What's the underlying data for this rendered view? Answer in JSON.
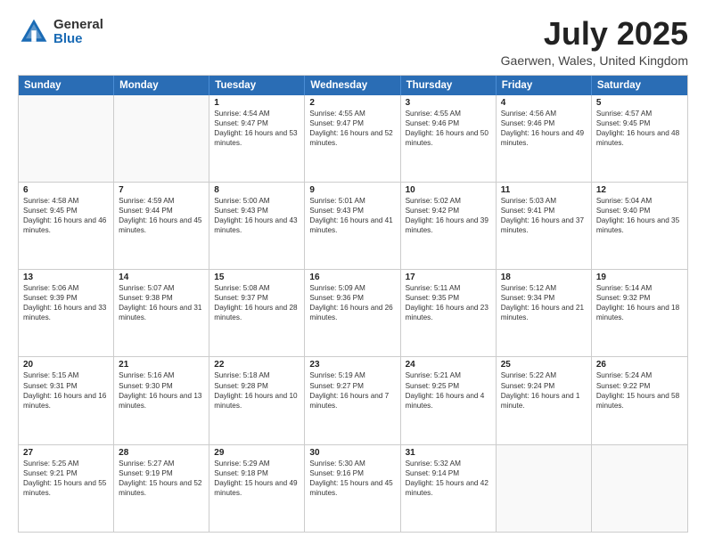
{
  "header": {
    "logo": {
      "general": "General",
      "blue": "Blue"
    },
    "title": "July 2025",
    "subtitle": "Gaerwen, Wales, United Kingdom"
  },
  "calendar": {
    "days": [
      "Sunday",
      "Monday",
      "Tuesday",
      "Wednesday",
      "Thursday",
      "Friday",
      "Saturday"
    ],
    "rows": [
      [
        {
          "day": "",
          "empty": true
        },
        {
          "day": "",
          "empty": true
        },
        {
          "day": "1",
          "sunrise": "Sunrise: 4:54 AM",
          "sunset": "Sunset: 9:47 PM",
          "daylight": "Daylight: 16 hours and 53 minutes."
        },
        {
          "day": "2",
          "sunrise": "Sunrise: 4:55 AM",
          "sunset": "Sunset: 9:47 PM",
          "daylight": "Daylight: 16 hours and 52 minutes."
        },
        {
          "day": "3",
          "sunrise": "Sunrise: 4:55 AM",
          "sunset": "Sunset: 9:46 PM",
          "daylight": "Daylight: 16 hours and 50 minutes."
        },
        {
          "day": "4",
          "sunrise": "Sunrise: 4:56 AM",
          "sunset": "Sunset: 9:46 PM",
          "daylight": "Daylight: 16 hours and 49 minutes."
        },
        {
          "day": "5",
          "sunrise": "Sunrise: 4:57 AM",
          "sunset": "Sunset: 9:45 PM",
          "daylight": "Daylight: 16 hours and 48 minutes."
        }
      ],
      [
        {
          "day": "6",
          "sunrise": "Sunrise: 4:58 AM",
          "sunset": "Sunset: 9:45 PM",
          "daylight": "Daylight: 16 hours and 46 minutes."
        },
        {
          "day": "7",
          "sunrise": "Sunrise: 4:59 AM",
          "sunset": "Sunset: 9:44 PM",
          "daylight": "Daylight: 16 hours and 45 minutes."
        },
        {
          "day": "8",
          "sunrise": "Sunrise: 5:00 AM",
          "sunset": "Sunset: 9:43 PM",
          "daylight": "Daylight: 16 hours and 43 minutes."
        },
        {
          "day": "9",
          "sunrise": "Sunrise: 5:01 AM",
          "sunset": "Sunset: 9:43 PM",
          "daylight": "Daylight: 16 hours and 41 minutes."
        },
        {
          "day": "10",
          "sunrise": "Sunrise: 5:02 AM",
          "sunset": "Sunset: 9:42 PM",
          "daylight": "Daylight: 16 hours and 39 minutes."
        },
        {
          "day": "11",
          "sunrise": "Sunrise: 5:03 AM",
          "sunset": "Sunset: 9:41 PM",
          "daylight": "Daylight: 16 hours and 37 minutes."
        },
        {
          "day": "12",
          "sunrise": "Sunrise: 5:04 AM",
          "sunset": "Sunset: 9:40 PM",
          "daylight": "Daylight: 16 hours and 35 minutes."
        }
      ],
      [
        {
          "day": "13",
          "sunrise": "Sunrise: 5:06 AM",
          "sunset": "Sunset: 9:39 PM",
          "daylight": "Daylight: 16 hours and 33 minutes."
        },
        {
          "day": "14",
          "sunrise": "Sunrise: 5:07 AM",
          "sunset": "Sunset: 9:38 PM",
          "daylight": "Daylight: 16 hours and 31 minutes."
        },
        {
          "day": "15",
          "sunrise": "Sunrise: 5:08 AM",
          "sunset": "Sunset: 9:37 PM",
          "daylight": "Daylight: 16 hours and 28 minutes."
        },
        {
          "day": "16",
          "sunrise": "Sunrise: 5:09 AM",
          "sunset": "Sunset: 9:36 PM",
          "daylight": "Daylight: 16 hours and 26 minutes."
        },
        {
          "day": "17",
          "sunrise": "Sunrise: 5:11 AM",
          "sunset": "Sunset: 9:35 PM",
          "daylight": "Daylight: 16 hours and 23 minutes."
        },
        {
          "day": "18",
          "sunrise": "Sunrise: 5:12 AM",
          "sunset": "Sunset: 9:34 PM",
          "daylight": "Daylight: 16 hours and 21 minutes."
        },
        {
          "day": "19",
          "sunrise": "Sunrise: 5:14 AM",
          "sunset": "Sunset: 9:32 PM",
          "daylight": "Daylight: 16 hours and 18 minutes."
        }
      ],
      [
        {
          "day": "20",
          "sunrise": "Sunrise: 5:15 AM",
          "sunset": "Sunset: 9:31 PM",
          "daylight": "Daylight: 16 hours and 16 minutes."
        },
        {
          "day": "21",
          "sunrise": "Sunrise: 5:16 AM",
          "sunset": "Sunset: 9:30 PM",
          "daylight": "Daylight: 16 hours and 13 minutes."
        },
        {
          "day": "22",
          "sunrise": "Sunrise: 5:18 AM",
          "sunset": "Sunset: 9:28 PM",
          "daylight": "Daylight: 16 hours and 10 minutes."
        },
        {
          "day": "23",
          "sunrise": "Sunrise: 5:19 AM",
          "sunset": "Sunset: 9:27 PM",
          "daylight": "Daylight: 16 hours and 7 minutes."
        },
        {
          "day": "24",
          "sunrise": "Sunrise: 5:21 AM",
          "sunset": "Sunset: 9:25 PM",
          "daylight": "Daylight: 16 hours and 4 minutes."
        },
        {
          "day": "25",
          "sunrise": "Sunrise: 5:22 AM",
          "sunset": "Sunset: 9:24 PM",
          "daylight": "Daylight: 16 hours and 1 minute."
        },
        {
          "day": "26",
          "sunrise": "Sunrise: 5:24 AM",
          "sunset": "Sunset: 9:22 PM",
          "daylight": "Daylight: 15 hours and 58 minutes."
        }
      ],
      [
        {
          "day": "27",
          "sunrise": "Sunrise: 5:25 AM",
          "sunset": "Sunset: 9:21 PM",
          "daylight": "Daylight: 15 hours and 55 minutes."
        },
        {
          "day": "28",
          "sunrise": "Sunrise: 5:27 AM",
          "sunset": "Sunset: 9:19 PM",
          "daylight": "Daylight: 15 hours and 52 minutes."
        },
        {
          "day": "29",
          "sunrise": "Sunrise: 5:29 AM",
          "sunset": "Sunset: 9:18 PM",
          "daylight": "Daylight: 15 hours and 49 minutes."
        },
        {
          "day": "30",
          "sunrise": "Sunrise: 5:30 AM",
          "sunset": "Sunset: 9:16 PM",
          "daylight": "Daylight: 15 hours and 45 minutes."
        },
        {
          "day": "31",
          "sunrise": "Sunrise: 5:32 AM",
          "sunset": "Sunset: 9:14 PM",
          "daylight": "Daylight: 15 hours and 42 minutes."
        },
        {
          "day": "",
          "empty": true
        },
        {
          "day": "",
          "empty": true
        }
      ]
    ]
  }
}
